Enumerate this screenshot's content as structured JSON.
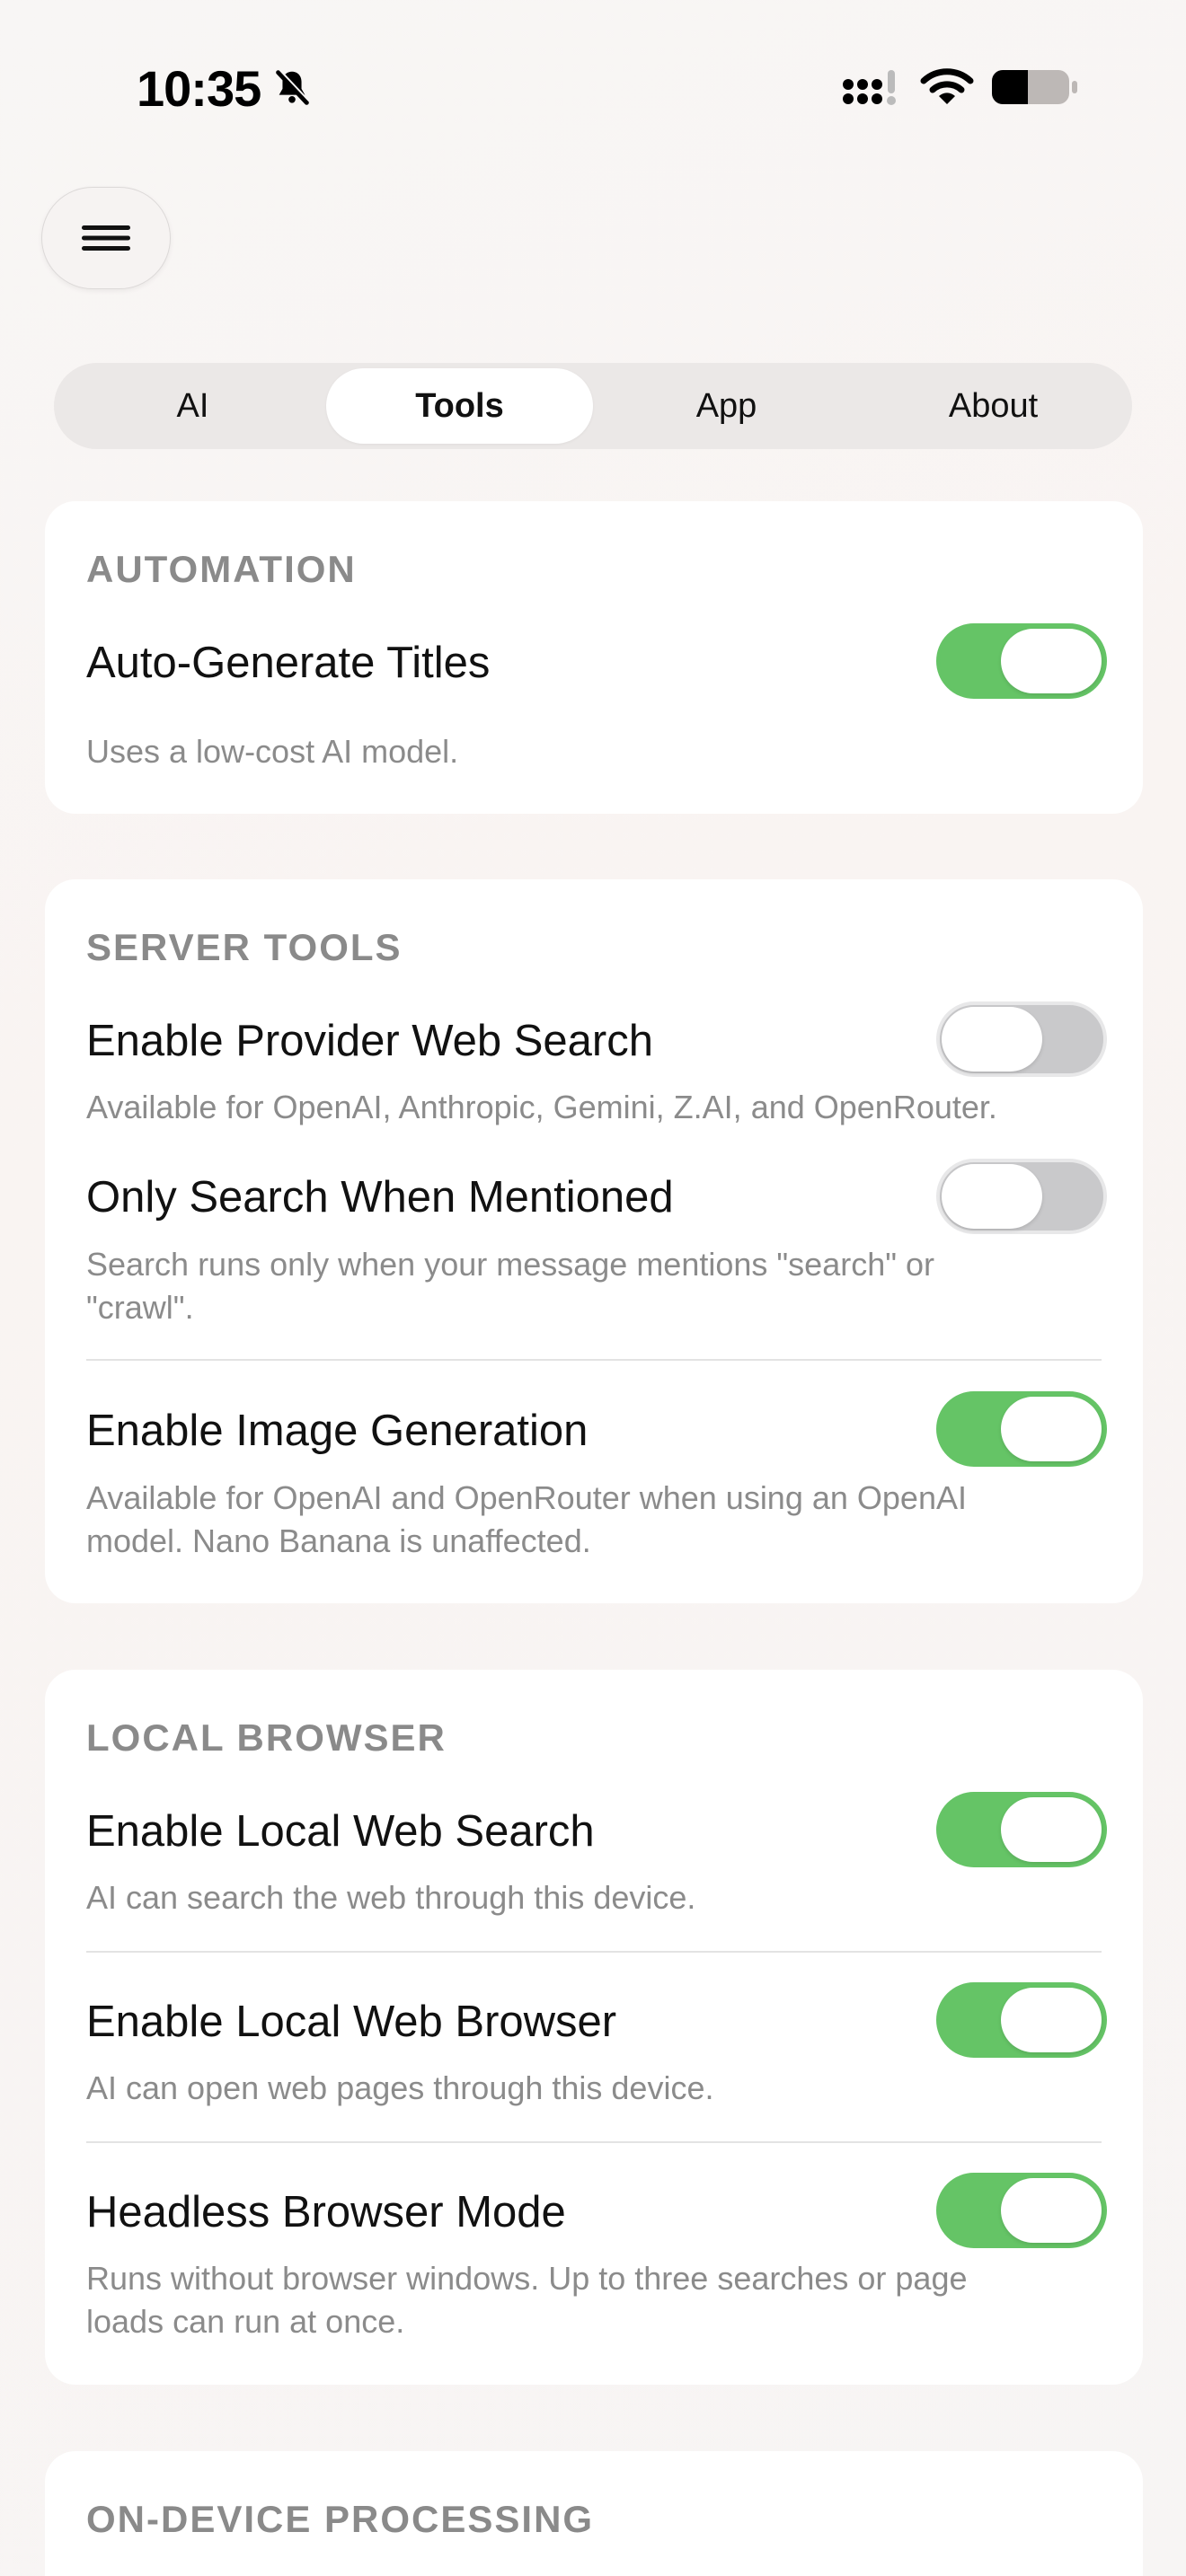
{
  "status_bar": {
    "time": "10:35",
    "icons": [
      "bell-slash-icon",
      "cellular-signal-icon",
      "wifi-icon",
      "battery-icon"
    ]
  },
  "menu_button": {
    "icon": "hamburger-menu-icon"
  },
  "tabs": [
    {
      "label": "AI",
      "active": false
    },
    {
      "label": "Tools",
      "active": true
    },
    {
      "label": "App",
      "active": false
    },
    {
      "label": "About",
      "active": false
    }
  ],
  "sections": {
    "automation": {
      "header": "AUTOMATION",
      "auto_titles": {
        "title": "Auto-Generate Titles",
        "description": "Uses a low-cost AI model.",
        "on": true
      }
    },
    "server_tools": {
      "header": "SERVER TOOLS",
      "provider_search": {
        "title": "Enable Provider Web Search",
        "description": "Available for OpenAI, Anthropic, Gemini, Z.AI, and OpenRouter.",
        "on": false
      },
      "only_when_mentioned": {
        "title": "Only Search When Mentioned",
        "description": "Search runs only when your message mentions \"search\" or \"crawl\".",
        "on": false
      },
      "image_generation": {
        "title": "Enable Image Generation",
        "description": "Available for OpenAI and OpenRouter when using an OpenAI model. Nano Banana is unaffected.",
        "on": true
      }
    },
    "local_browser": {
      "header": "LOCAL BROWSER",
      "local_search": {
        "title": "Enable Local Web Search",
        "description": "AI can search the web through this device.",
        "on": true
      },
      "local_browser": {
        "title": "Enable Local Web Browser",
        "description": "AI can open web pages through this device.",
        "on": true
      },
      "headless": {
        "title": "Headless Browser Mode",
        "description": "Runs without browser windows. Up to three searches or page loads can run at once.",
        "on": true
      }
    },
    "on_device": {
      "header": "ON-DEVICE PROCESSING"
    }
  },
  "colors": {
    "toggle_on": "#65c466",
    "toggle_off": "#c9c9cb",
    "section_header": "#8a8a8a",
    "description": "#8b8b8b"
  }
}
